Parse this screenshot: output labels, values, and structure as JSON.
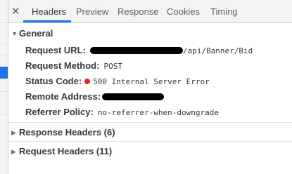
{
  "tabs": {
    "close_glyph": "✕",
    "items": [
      {
        "label": "Headers",
        "active": true
      },
      {
        "label": "Preview",
        "active": false
      },
      {
        "label": "Response",
        "active": false
      },
      {
        "label": "Cookies",
        "active": false
      },
      {
        "label": "Timing",
        "active": false
      }
    ]
  },
  "general": {
    "title": "General",
    "expanded": true,
    "request_url": {
      "label": "Request URL:",
      "value_visible": "/api/Banner/Bid"
    },
    "request_method": {
      "label": "Request Method:",
      "value": "POST"
    },
    "status_code": {
      "label": "Status Code:",
      "value": "500 Internal Server Error",
      "dot_color": "#e8202a"
    },
    "remote_address": {
      "label": "Remote Address:"
    },
    "referrer_policy": {
      "label": "Referrer Policy:",
      "value": "no-referrer-when-downgrade"
    }
  },
  "response_headers": {
    "title": "Response Headers (6)",
    "expanded": false
  },
  "request_headers": {
    "title": "Request Headers (11)",
    "expanded": false
  },
  "colors": {
    "accent": "#1a73e8",
    "text": "#303942",
    "muted": "#5f6368",
    "error": "#e8202a"
  }
}
